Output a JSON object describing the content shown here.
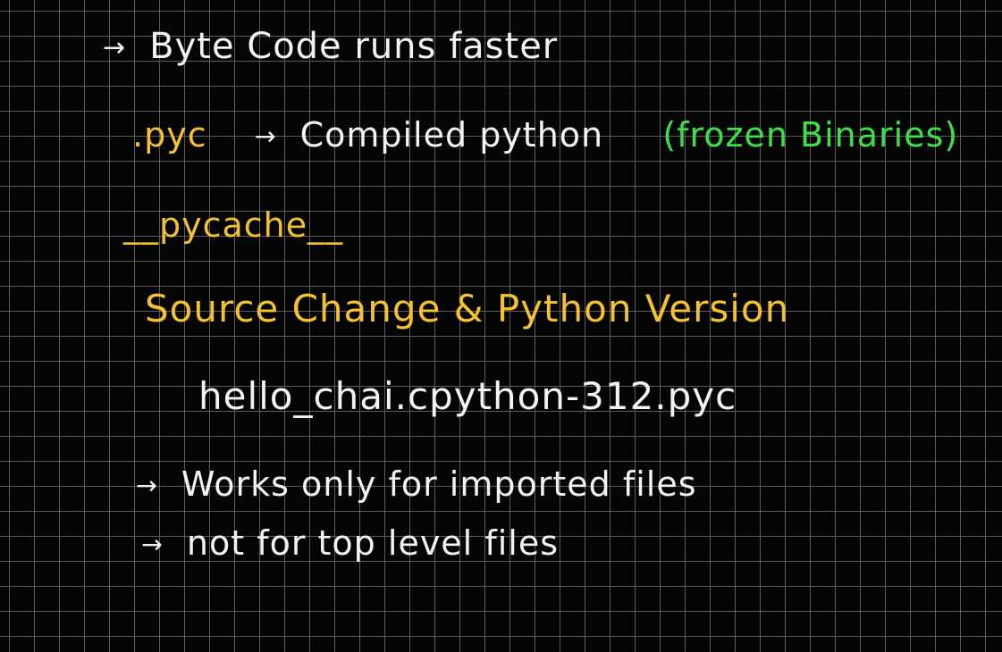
{
  "notes": {
    "arrow": "→",
    "line1": "Byte Code runs faster",
    "line2_ext": ".pyc",
    "line2_text": "Compiled python",
    "line2_note": "(frozen Binaries)",
    "line3": "__pycache__",
    "line4": "Source Change & Python Version",
    "line5": "hello_chai.cpython-312.pyc",
    "line6": "Works only for imported files",
    "line7": "not for top level files"
  },
  "colors": {
    "background": "#050505",
    "grid": "#5c5c5c",
    "white_ink": "#f2f2f2",
    "yellow_ink": "#f2c230",
    "green_ink": "#3ee04a"
  }
}
